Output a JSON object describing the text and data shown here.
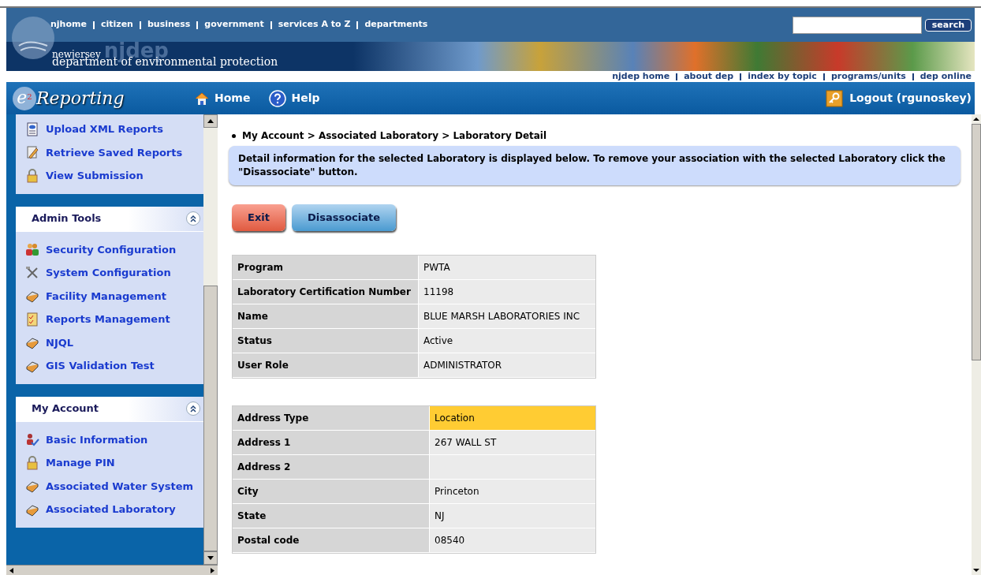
{
  "top_nav": {
    "links": [
      "njhome",
      "citizen",
      "business",
      "government",
      "services A to Z",
      "departments"
    ],
    "search_button": "search"
  },
  "banner": {
    "small": "newjersey",
    "logo": "njdep",
    "title": "department of environmental protection",
    "links": [
      "njdep home",
      "about dep",
      "index by topic",
      "programs/units",
      "dep online"
    ]
  },
  "app_bar": {
    "logo_letter": "e",
    "logo_sup": "2",
    "logo": "Reporting",
    "nav": [
      {
        "label": "Home",
        "kind": "home"
      },
      {
        "label": "Help",
        "kind": "help"
      }
    ],
    "logout": "Logout (rgunoskey)"
  },
  "sidebar": {
    "top_items": [
      {
        "label": "Upload XML Reports",
        "kind": "xml"
      },
      {
        "label": "Retrieve Saved Reports",
        "kind": "edit"
      },
      {
        "label": "View Submission",
        "kind": "lock"
      }
    ],
    "panels": [
      {
        "title": "Admin Tools",
        "expanded": true,
        "items": [
          {
            "label": "Security Configuration",
            "kind": "users"
          },
          {
            "label": "System Configuration",
            "kind": "tools"
          },
          {
            "label": "Facility Management",
            "kind": "box"
          },
          {
            "label": "Reports Management",
            "kind": "report"
          },
          {
            "label": "NJQL",
            "kind": "box"
          },
          {
            "label": "GIS Validation Test",
            "kind": "box"
          }
        ]
      },
      {
        "title": "My Account",
        "expanded": true,
        "items": [
          {
            "label": "Basic Information",
            "kind": "user"
          },
          {
            "label": "Manage PIN",
            "kind": "lock"
          },
          {
            "label": "Associated Water System",
            "kind": "box"
          },
          {
            "label": "Associated Laboratory",
            "kind": "box"
          }
        ]
      }
    ]
  },
  "breadcrumb": "My Account > Associated Laboratory > Laboratory Detail",
  "info": "Detail information for the selected Laboratory is displayed below. To remove your association with the selected Laboratory click the \"Disassociate\" button.",
  "buttons": [
    {
      "label": "Exit",
      "kind": "red"
    },
    {
      "label": "Disassociate",
      "kind": "blue"
    }
  ],
  "lab_table": [
    {
      "label": "Program",
      "value": "PWTA"
    },
    {
      "label": "Laboratory Certification Number",
      "value": "11198"
    },
    {
      "label": "Name",
      "value": "BLUE MARSH LABORATORIES INC"
    },
    {
      "label": "Status",
      "value": "Active"
    },
    {
      "label": "User Role",
      "value": "ADMINISTRATOR"
    }
  ],
  "address_table": [
    {
      "label": "Address Type",
      "value": "Location",
      "highlighted": true
    },
    {
      "label": "Address 1",
      "value": "267 WALL ST",
      "highlighted": false
    },
    {
      "label": "Address 2",
      "highlighted": false
    },
    {
      "label": "City",
      "value": "Princeton",
      "highlighted": false
    },
    {
      "label": "State",
      "value": "NJ",
      "highlighted": false
    },
    {
      "label": "Postal code",
      "value": "08540",
      "highlighted": false
    }
  ]
}
